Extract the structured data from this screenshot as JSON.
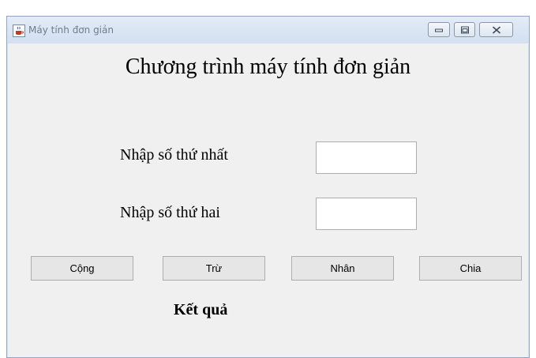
{
  "window": {
    "title": "Máy tính đơn giản",
    "icon": "java-cup-icon",
    "controls": [
      "minimize-icon",
      "maximize-icon",
      "close-icon"
    ]
  },
  "main": {
    "heading": "Chương trình máy tính đơn giản",
    "first_label": "Nhập số thứ nhất",
    "first_value": "",
    "second_label": "Nhập số thứ hai",
    "second_value": "",
    "result_label": "Kết quả"
  },
  "buttons": {
    "add": "Cộng",
    "subtract": "Trừ",
    "multiply": "Nhân",
    "divide": "Chia"
  }
}
